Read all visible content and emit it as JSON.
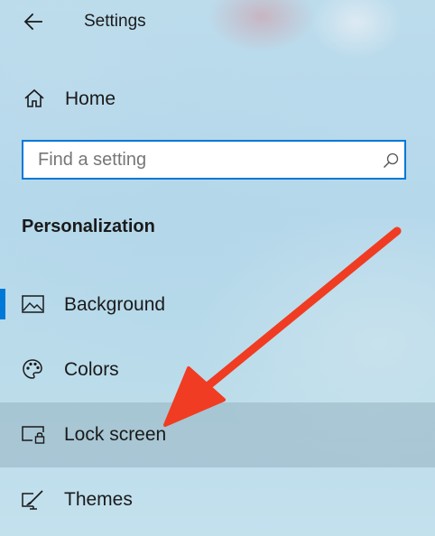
{
  "header": {
    "back_icon": "back-arrow-icon",
    "title": "Settings"
  },
  "home": {
    "label": "Home",
    "icon": "home-icon"
  },
  "search": {
    "placeholder": "Find a setting",
    "icon": "search-icon"
  },
  "section": {
    "title": "Personalization"
  },
  "nav": {
    "items": [
      {
        "label": "Background",
        "icon": "picture-icon",
        "selected": true
      },
      {
        "label": "Colors",
        "icon": "palette-icon",
        "selected": false
      },
      {
        "label": "Lock screen",
        "icon": "lock-screen-icon",
        "selected": false,
        "hovered": true
      },
      {
        "label": "Themes",
        "icon": "brush-icon",
        "selected": false
      }
    ]
  },
  "colors": {
    "accent": "#0078d7",
    "annotation_arrow": "#f03c22",
    "text": "#1a1a1a"
  }
}
